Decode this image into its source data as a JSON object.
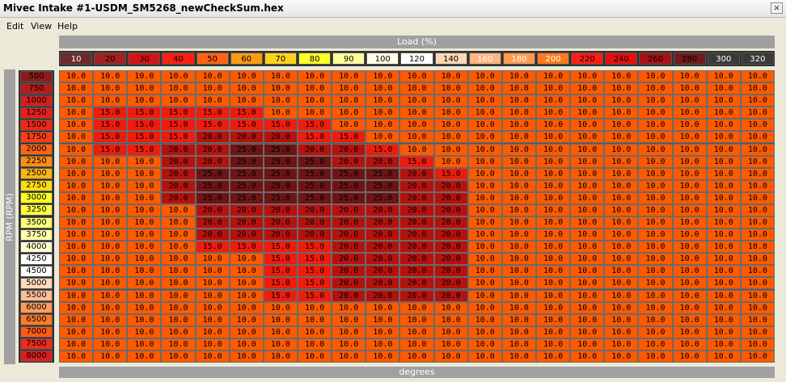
{
  "window": {
    "title": "Mivec Intake #1-USDM_SM5268_newCheckSum.hex",
    "close_glyph": "×"
  },
  "menu": {
    "items": [
      "Edit",
      "View",
      "Help"
    ]
  },
  "axes": {
    "load_label": "Load (%)",
    "rpm_label": "RPM (RPM)",
    "value_label": "degrees"
  },
  "columns": [
    "10",
    "20",
    "30",
    "40",
    "50",
    "60",
    "70",
    "80",
    "90",
    "100",
    "120",
    "140",
    "160",
    "180",
    "200",
    "220",
    "240",
    "260",
    "280",
    "300",
    "320"
  ],
  "rows": [
    "500",
    "750",
    "1000",
    "1250",
    "1500",
    "1750",
    "2000",
    "2250",
    "2500",
    "2750",
    "3000",
    "3250",
    "3500",
    "3750",
    "4000",
    "4250",
    "4500",
    "5000",
    "5500",
    "6000",
    "6500",
    "7000",
    "7500",
    "8000"
  ],
  "values": [
    [
      "10.0",
      "10.0",
      "10.0",
      "10.0",
      "10.0",
      "10.0",
      "10.0",
      "10.0",
      "10.0",
      "10.0",
      "10.0",
      "10.0",
      "10.0",
      "10.0",
      "10.0",
      "10.0",
      "10.0",
      "10.0",
      "10.0",
      "10.0",
      "10.0"
    ],
    [
      "10.0",
      "10.0",
      "10.0",
      "10.0",
      "10.0",
      "10.0",
      "10.0",
      "10.0",
      "10.0",
      "10.0",
      "10.0",
      "10.0",
      "10.0",
      "10.0",
      "10.0",
      "10.0",
      "10.0",
      "10.0",
      "10.0",
      "10.0",
      "10.0"
    ],
    [
      "10.0",
      "10.0",
      "10.0",
      "10.0",
      "10.0",
      "10.0",
      "10.0",
      "10.0",
      "10.0",
      "10.0",
      "10.0",
      "10.0",
      "10.0",
      "10.0",
      "10.0",
      "10.0",
      "10.0",
      "10.0",
      "10.0",
      "10.0",
      "10.0"
    ],
    [
      "10.0",
      "15.0",
      "15.0",
      "15.0",
      "15.0",
      "15.0",
      "10.0",
      "10.0",
      "10.0",
      "10.0",
      "10.0",
      "10.0",
      "10.0",
      "10.0",
      "10.0",
      "10.0",
      "10.0",
      "10.0",
      "10.0",
      "10.0",
      "10.0"
    ],
    [
      "10.0",
      "15.0",
      "15.0",
      "15.0",
      "15.0",
      "15.0",
      "15.0",
      "15.0",
      "10.0",
      "10.0",
      "10.0",
      "10.0",
      "10.0",
      "10.0",
      "10.0",
      "10.0",
      "10.0",
      "10.0",
      "10.0",
      "10.0",
      "10.0"
    ],
    [
      "10.0",
      "15.0",
      "15.0",
      "15.0",
      "20.0",
      "20.0",
      "20.0",
      "15.0",
      "15.0",
      "10.0",
      "10.0",
      "10.0",
      "10.0",
      "10.0",
      "10.0",
      "10.0",
      "10.0",
      "10.0",
      "10.0",
      "10.0",
      "10.0"
    ],
    [
      "10.0",
      "15.0",
      "15.0",
      "20.0",
      "20.0",
      "25.0",
      "25.0",
      "20.0",
      "20.0",
      "15.0",
      "10.0",
      "10.0",
      "10.0",
      "10.0",
      "10.0",
      "10.0",
      "10.0",
      "10.0",
      "10.0",
      "10.0",
      "10.0"
    ],
    [
      "10.0",
      "10.0",
      "10.0",
      "20.0",
      "20.0",
      "25.0",
      "25.0",
      "25.0",
      "20.0",
      "20.0",
      "15.0",
      "10.0",
      "10.0",
      "10.0",
      "10.0",
      "10.0",
      "10.0",
      "10.0",
      "10.0",
      "10.0",
      "10.0"
    ],
    [
      "10.0",
      "10.0",
      "10.0",
      "20.0",
      "25.0",
      "25.0",
      "25.0",
      "25.0",
      "25.0",
      "25.0",
      "20.0",
      "15.0",
      "10.0",
      "10.0",
      "10.0",
      "10.0",
      "10.0",
      "10.0",
      "10.0",
      "10.0",
      "10.0"
    ],
    [
      "10.0",
      "10.0",
      "10.0",
      "20.0",
      "25.0",
      "25.0",
      "25.0",
      "25.0",
      "25.0",
      "25.0",
      "20.0",
      "20.0",
      "10.0",
      "10.0",
      "10.0",
      "10.0",
      "10.0",
      "10.0",
      "10.0",
      "10.0",
      "10.0"
    ],
    [
      "10.0",
      "10.0",
      "10.0",
      "20.0",
      "25.0",
      "25.0",
      "25.0",
      "25.0",
      "25.0",
      "25.0",
      "20.0",
      "20.0",
      "10.0",
      "10.0",
      "10.0",
      "10.0",
      "10.0",
      "10.0",
      "10.0",
      "10.0",
      "10.0"
    ],
    [
      "10.0",
      "10.0",
      "10.0",
      "10.0",
      "20.0",
      "20.0",
      "20.0",
      "20.0",
      "20.0",
      "20.0",
      "20.0",
      "20.0",
      "10.0",
      "10.0",
      "10.0",
      "10.0",
      "10.0",
      "10.0",
      "10.0",
      "10.0",
      "10.0"
    ],
    [
      "10.0",
      "10.0",
      "10.0",
      "10.0",
      "20.0",
      "20.0",
      "20.0",
      "20.0",
      "20.0",
      "20.0",
      "20.0",
      "20.0",
      "10.0",
      "10.0",
      "10.0",
      "10.0",
      "10.0",
      "10.0",
      "10.0",
      "10.0",
      "10.0"
    ],
    [
      "10.0",
      "10.0",
      "10.0",
      "10.0",
      "20.0",
      "20.0",
      "20.0",
      "20.0",
      "20.0",
      "20.0",
      "20.0",
      "20.0",
      "10.0",
      "10.0",
      "10.0",
      "10.0",
      "10.0",
      "10.0",
      "10.0",
      "10.0",
      "10.0"
    ],
    [
      "10.0",
      "10.0",
      "10.0",
      "10.0",
      "15.0",
      "15.0",
      "15.0",
      "15.0",
      "20.0",
      "20.0",
      "20.0",
      "20.0",
      "10.0",
      "10.0",
      "10.0",
      "10.0",
      "10.0",
      "10.0",
      "10.0",
      "10.0",
      "10.0"
    ],
    [
      "10.0",
      "10.0",
      "10.0",
      "10.0",
      "10.0",
      "10.0",
      "15.0",
      "15.0",
      "20.0",
      "20.0",
      "20.0",
      "20.0",
      "10.0",
      "10.0",
      "10.0",
      "10.0",
      "10.0",
      "10.0",
      "10.0",
      "10.0",
      "10.0"
    ],
    [
      "10.0",
      "10.0",
      "10.0",
      "10.0",
      "10.0",
      "10.0",
      "15.0",
      "15.0",
      "20.0",
      "20.0",
      "20.0",
      "20.0",
      "10.0",
      "10.0",
      "10.0",
      "10.0",
      "10.0",
      "10.0",
      "10.0",
      "10.0",
      "10.0"
    ],
    [
      "10.0",
      "10.0",
      "10.0",
      "10.0",
      "10.0",
      "10.0",
      "15.0",
      "15.0",
      "20.0",
      "20.0",
      "20.0",
      "20.0",
      "10.0",
      "10.0",
      "10.0",
      "10.0",
      "10.0",
      "10.0",
      "10.0",
      "10.0",
      "10.0"
    ],
    [
      "10.0",
      "10.0",
      "10.0",
      "10.0",
      "10.0",
      "10.0",
      "15.0",
      "15.0",
      "20.0",
      "20.0",
      "20.0",
      "20.0",
      "10.0",
      "10.0",
      "10.0",
      "10.0",
      "10.0",
      "10.0",
      "10.0",
      "10.0",
      "10.0"
    ],
    [
      "10.0",
      "10.0",
      "10.0",
      "10.0",
      "10.0",
      "10.0",
      "10.0",
      "10.0",
      "10.0",
      "10.0",
      "10.0",
      "10.0",
      "10.0",
      "10.0",
      "10.0",
      "10.0",
      "10.0",
      "10.0",
      "10.0",
      "10.0",
      "10.0"
    ],
    [
      "10.0",
      "10.0",
      "10.0",
      "10.0",
      "10.0",
      "10.0",
      "10.0",
      "10.0",
      "10.0",
      "10.0",
      "10.0",
      "10.0",
      "10.0",
      "10.0",
      "10.0",
      "10.0",
      "10.0",
      "10.0",
      "10.0",
      "10.0",
      "10.0"
    ],
    [
      "10.0",
      "10.0",
      "10.0",
      "10.0",
      "10.0",
      "10.0",
      "10.0",
      "10.0",
      "10.0",
      "10.0",
      "10.0",
      "10.0",
      "10.0",
      "10.0",
      "10.0",
      "10.0",
      "10.0",
      "10.0",
      "10.0",
      "10.0",
      "10.0"
    ],
    [
      "10.0",
      "10.0",
      "10.0",
      "10.0",
      "10.0",
      "10.0",
      "10.0",
      "10.0",
      "10.0",
      "10.0",
      "10.0",
      "10.0",
      "10.0",
      "10.0",
      "10.0",
      "10.0",
      "10.0",
      "10.0",
      "10.0",
      "10.0",
      "10.0"
    ],
    [
      "10.0",
      "10.0",
      "10.0",
      "10.0",
      "10.0",
      "10.0",
      "10.0",
      "10.0",
      "10.0",
      "10.0",
      "10.0",
      "10.0",
      "10.0",
      "10.0",
      "10.0",
      "10.0",
      "10.0",
      "10.0",
      "10.0",
      "10.0",
      "10.0"
    ]
  ],
  "value_colors": {
    "10.0": "#ff5a00",
    "15.0": "#ee1c0c",
    "20.0": "#b5120e",
    "25.0": "#6e1414"
  },
  "column_colors": [
    "#6e2a2a",
    "#a32020",
    "#d41414",
    "#ff1e14",
    "#ff6414",
    "#ff9a14",
    "#ffd21e",
    "#ffff28",
    "#ffff9a",
    "#ffffe6",
    "#ffffff",
    "#ffd7b4",
    "#ffb482",
    "#ff9b50",
    "#ff7a1e",
    "#ff1e14",
    "#e60f0f",
    "#a51414",
    "#6e1c1c",
    "#3a3a3a",
    "#3a3a3a"
  ],
  "column_text_colors": [
    "#fff",
    "#000",
    "#000",
    "#000",
    "#000",
    "#000",
    "#000",
    "#000",
    "#000",
    "#000",
    "#000",
    "#000",
    "#fff",
    "#fff",
    "#fff",
    "#000",
    "#000",
    "#000",
    "#000",
    "#fff",
    "#fff"
  ],
  "row_colors": [
    "#8c1c1c",
    "#b41c1c",
    "#d21e1e",
    "#e61e1e",
    "#f02814",
    "#ff3c14",
    "#ff6414",
    "#ff8c14",
    "#ffb414",
    "#ffdc14",
    "#ffff1e",
    "#ffff3c",
    "#ffff78",
    "#ffffaa",
    "#ffffd2",
    "#ffffff",
    "#ffffff",
    "#ffdcbe",
    "#ffbe96",
    "#ff9a5a",
    "#ff7a28",
    "#ff5a14",
    "#f0281e",
    "#dc1e1e"
  ]
}
